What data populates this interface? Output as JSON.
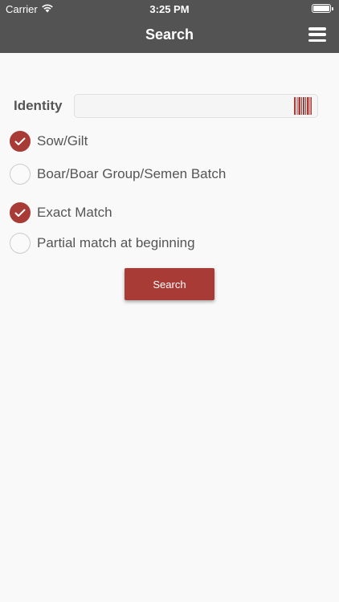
{
  "status_bar": {
    "carrier": "Carrier",
    "time": "3:25 PM"
  },
  "header": {
    "title": "Search",
    "menu_icon": "hamburger-menu-icon"
  },
  "form": {
    "identity_label": "Identity",
    "identity_value": "",
    "identity_placeholder": "",
    "barcode_icon": "barcode-scan-icon",
    "type_options": [
      {
        "label": "Sow/Gilt",
        "checked": true
      },
      {
        "label": "Boar/Boar Group/Semen Batch",
        "checked": false
      }
    ],
    "match_options": [
      {
        "label": "Exact Match",
        "checked": true
      },
      {
        "label": "Partial match at beginning",
        "checked": false
      }
    ],
    "search_label": "Search"
  },
  "colors": {
    "header_bg": "#535353",
    "accent": "#a93b36",
    "background": "#f9f9f9"
  }
}
